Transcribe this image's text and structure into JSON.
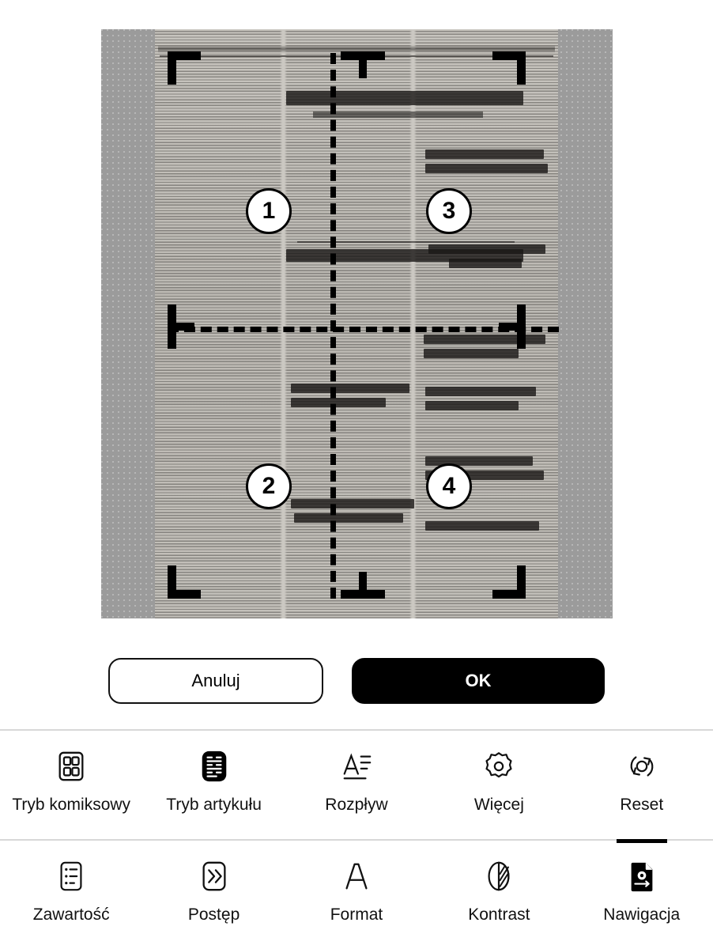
{
  "dialog": {
    "preview": {
      "name": "newspaper-scan-crop-preview",
      "crop_regions": [
        {
          "number": "1"
        },
        {
          "number": "2"
        },
        {
          "number": "3"
        },
        {
          "number": "4"
        }
      ]
    },
    "buttons": {
      "cancel_label": "Anuluj",
      "ok_label": "OK"
    }
  },
  "toolbars": {
    "primary": {
      "items": [
        {
          "label": "Tryb komiksowy",
          "icon": "comic-grid-icon",
          "active": false
        },
        {
          "label": "Tryb artykułu",
          "icon": "article-mode-icon",
          "active": true
        },
        {
          "label": "Rozpływ",
          "icon": "reflow-text-icon",
          "active": false
        },
        {
          "label": "Więcej",
          "icon": "gear-icon",
          "active": false
        },
        {
          "label": "Reset",
          "icon": "reset-rotate-icon",
          "active": false
        }
      ]
    },
    "secondary": {
      "items": [
        {
          "label": "Zawartość",
          "icon": "table-of-contents-icon",
          "active": false
        },
        {
          "label": "Postęp",
          "icon": "fast-forward-icon",
          "active": false
        },
        {
          "label": "Format",
          "icon": "letter-a-icon",
          "active": false
        },
        {
          "label": "Kontrast",
          "icon": "contrast-circle-icon",
          "active": false
        },
        {
          "label": "Nawigacja",
          "icon": "navigation-page-icon",
          "active": true
        }
      ]
    }
  },
  "colors": {
    "accent": "#000000",
    "background": "#ffffff",
    "canvas": "#9b9b9b",
    "divider": "#d8d8d8"
  }
}
